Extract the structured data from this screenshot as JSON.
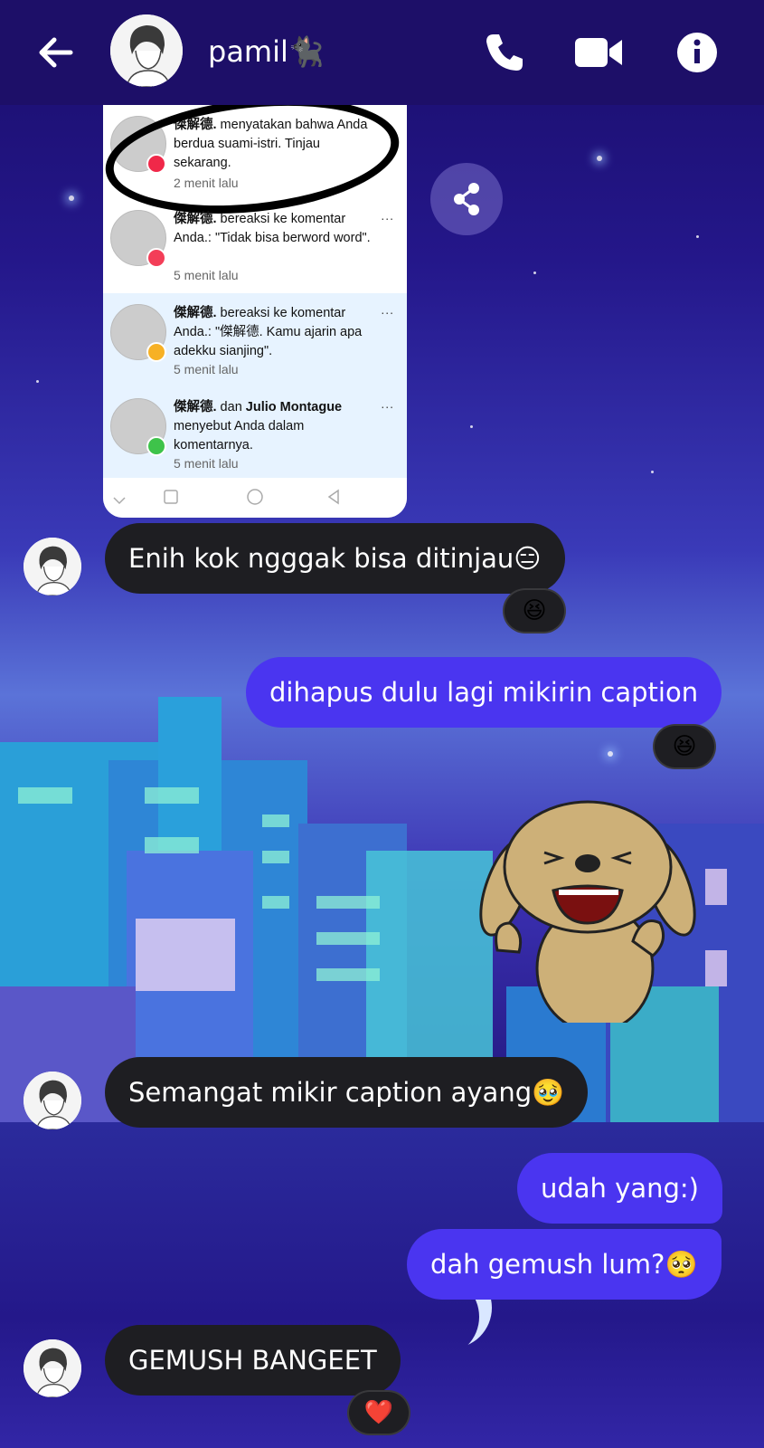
{
  "header": {
    "contact_name": "pamil🐈‍⬛",
    "back_icon": "arrow-left-icon",
    "call_icon": "phone-icon",
    "video_icon": "video-camera-icon",
    "info_icon": "info-icon"
  },
  "shared_screenshot": {
    "notifications": [
      {
        "name": "傑解德.",
        "text": " menyatakan bahwa Anda berdua suami-istri. Tinjau sekarang.",
        "time": "2 menit lalu",
        "badge_color": "#f02849",
        "highlighted": false
      },
      {
        "name": "傑解德.",
        "text": " bereaksi ke komentar Anda.: \"Tidak bisa berword word\".",
        "time": "5 menit lalu",
        "badge_color": "#f33e58",
        "highlighted": false
      },
      {
        "name": "傑解德.",
        "text": " bereaksi ke komentar Anda.: \"傑解德. Kamu ajarin apa adekku sianjing\".",
        "time": "5 menit lalu",
        "badge_color": "#f7b125",
        "highlighted": true
      },
      {
        "name": "傑解德.",
        "text": " dan ",
        "name2": "Julio Montague",
        "text2": " menyebut Anda dalam komentarnya.",
        "time": "5 menit lalu",
        "badge_color": "#3ec34a",
        "highlighted": true
      }
    ],
    "more_label": "..."
  },
  "share_icon": "share-icon",
  "messages": {
    "m1": "Enih kok ngggak bisa ditinjau😑",
    "m1_reaction": "😆",
    "m2": "dihapus dulu lagi mikirin caption",
    "m2_reaction": "😆",
    "m3": "Semangat mikir caption ayang🥹",
    "m4": "udah yang:)",
    "m5": "dah gemush lum?🥺",
    "m6": "GEMUSH BANGEET",
    "m6_reaction": "❤️"
  },
  "colors": {
    "incoming_bubble": "#1e1e22",
    "outgoing_bubble": "#4a35f0",
    "header_bg": "#1d0f68"
  }
}
